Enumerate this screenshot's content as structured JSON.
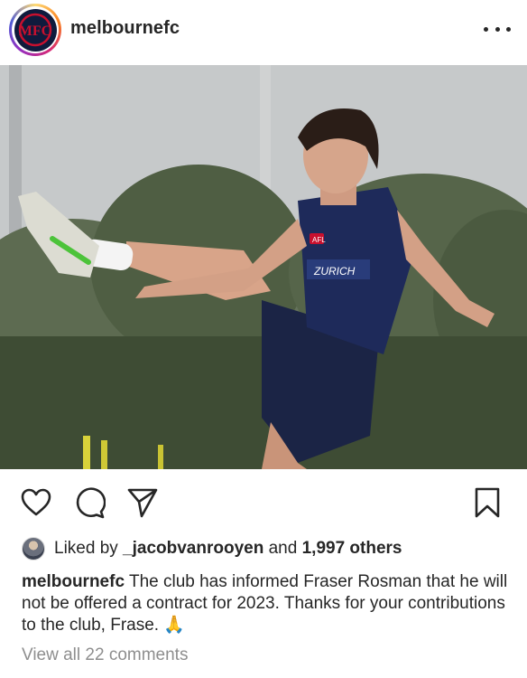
{
  "post": {
    "username": "melbournefc",
    "more_icon": "more-horizontal-icon",
    "avatar_icon": "melbourne-fc-logo",
    "avatar_monogram": "MFC",
    "photo_sponsor": "ZURICH",
    "photo_badge": "AFL"
  },
  "actions": {
    "like_icon": "heart-icon",
    "comment_icon": "comment-icon",
    "share_icon": "send-icon",
    "save_icon": "bookmark-icon"
  },
  "likes": {
    "prefix": "Liked by ",
    "user": "_jacobvanrooyen",
    "middle": " and ",
    "count": "1,997 others"
  },
  "caption": {
    "username": "melbournefc",
    "text": " The club has informed Fraser Rosman that he will not be offered a contract for 2023. Thanks for your contributions to the club, Frase. 🙏"
  },
  "comments": {
    "label": "View all 22 comments"
  },
  "colors": {
    "text": "#262626",
    "muted": "#8e8e8e",
    "club_navy": "#0f1b3d",
    "club_red": "#c8102e"
  }
}
